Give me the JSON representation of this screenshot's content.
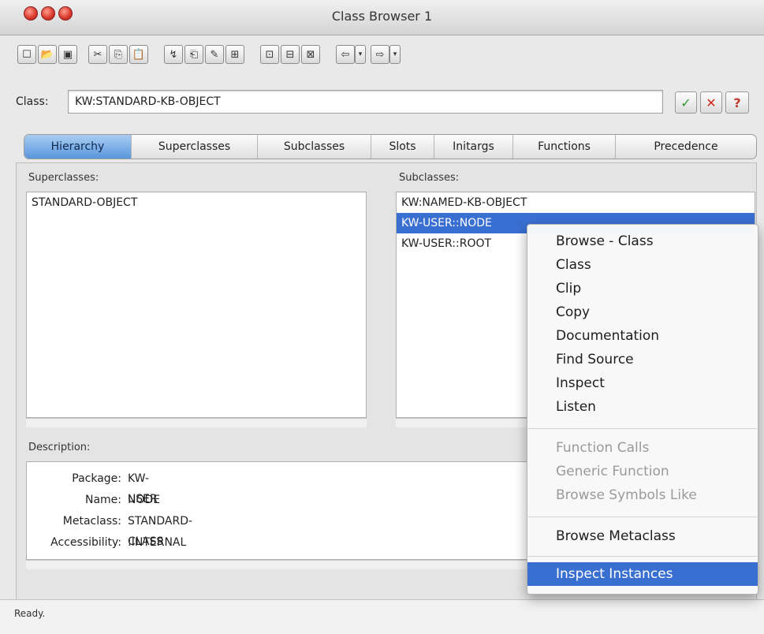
{
  "window": {
    "title": "Class Browser 1"
  },
  "toolbar": {
    "buttons": [
      {
        "icon": "new-document-icon",
        "glyph": "☐"
      },
      {
        "icon": "open-folder-icon",
        "glyph": "📂"
      },
      {
        "icon": "save-icon",
        "glyph": "▣"
      },
      {
        "icon": "cut-icon",
        "glyph": "✂"
      },
      {
        "icon": "copy-icon",
        "glyph": "⎘"
      },
      {
        "icon": "paste-icon",
        "glyph": "📋"
      },
      {
        "icon": "browse-icon",
        "glyph": "↯"
      },
      {
        "icon": "clip-icon",
        "glyph": "⎗"
      },
      {
        "icon": "edit-icon",
        "glyph": "✎"
      },
      {
        "icon": "tree-icon",
        "glyph": "⊞"
      },
      {
        "icon": "window-icon-1",
        "glyph": "⊡"
      },
      {
        "icon": "window-icon-2",
        "glyph": "⊟"
      },
      {
        "icon": "window-icon-3",
        "glyph": "⊠"
      },
      {
        "icon": "back-arrow-icon",
        "glyph": "⇦"
      },
      {
        "icon": "back-history-icon",
        "glyph": "▾"
      },
      {
        "icon": "forward-arrow-icon",
        "glyph": "⇨"
      },
      {
        "icon": "forward-history-icon",
        "glyph": "▾"
      }
    ]
  },
  "class_field": {
    "label": "Class:",
    "value": "KW:STANDARD-KB-OBJECT"
  },
  "class_buttons": {
    "ok": "✓",
    "cancel": "✕",
    "help": "?"
  },
  "colors": {
    "accent": "#3a6fd2",
    "ok": "#2e9a2e",
    "cancel": "#d22a1e",
    "help": "#c0392b"
  },
  "tabs": [
    "Hierarchy",
    "Superclasses",
    "Subclasses",
    "Slots",
    "Initargs",
    "Functions",
    "Precedence"
  ],
  "active_tab": "Hierarchy",
  "superclasses": {
    "label": "Superclasses:",
    "items": [
      "STANDARD-OBJECT"
    ]
  },
  "subclasses": {
    "label": "Subclasses:",
    "items": [
      "KW:NAMED-KB-OBJECT",
      "KW-USER::NODE",
      "KW-USER::ROOT"
    ],
    "selected": "KW-USER::NODE"
  },
  "description": {
    "label": "Description:",
    "rows": [
      {
        "key": "Package:",
        "value": "KW-USER"
      },
      {
        "key": "Name:",
        "value": "NODE"
      },
      {
        "key": "Metaclass:",
        "value": "STANDARD-CLASS"
      },
      {
        "key": "Accessibility:",
        "value": ":INTERNAL"
      }
    ]
  },
  "status": "Ready.",
  "context_menu": {
    "group1": [
      "Browse - Class",
      "Class",
      "Clip",
      "Copy",
      "Documentation",
      "Find Source",
      "Inspect",
      "Listen"
    ],
    "group2_disabled": [
      "Function Calls",
      "Generic Function",
      "Browse Symbols Like"
    ],
    "group3": [
      "Browse Metaclass"
    ],
    "group4": [
      "Inspect Instances"
    ],
    "highlighted": "Inspect Instances"
  }
}
